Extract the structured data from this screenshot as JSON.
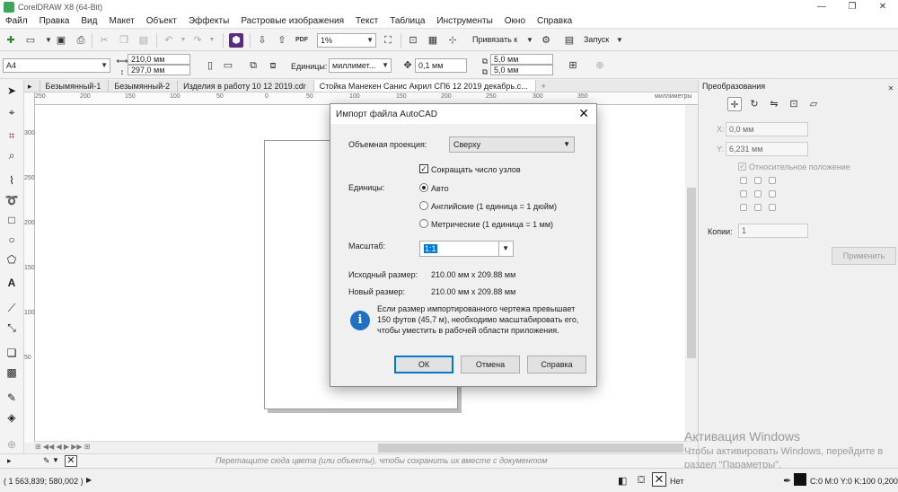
{
  "window": {
    "title": "CorelDRAW X8 (64-Bit)",
    "min": "—",
    "max": "❐",
    "close": "✕"
  },
  "menu": [
    "Файл",
    "Правка",
    "Вид",
    "Макет",
    "Объект",
    "Эффекты",
    "Растровые изображения",
    "Текст",
    "Таблица",
    "Инструменты",
    "Окно",
    "Справка"
  ],
  "toolbar1": {
    "zoom": "1%",
    "snap": "Привязать к",
    "launch": "Запуск",
    "pdf": "PDF"
  },
  "toolbar2": {
    "page_size": "A4",
    "width": "210,0 мм",
    "height": "297,0 мм",
    "units_label": "Единицы:",
    "units": "миллимет...",
    "nudge": "0,1 мм",
    "dup_x": "5,0 мм",
    "dup_y": "5,0 мм"
  },
  "tabs": [
    "Безымянный-1",
    "Безымянный-2",
    "Изделия в работу 10 12 2019.cdr",
    "Стойка  Манекен Санис Акрил СП6  12 2019 декабрь.c..."
  ],
  "ruler": {
    "h_ticks": [
      "250",
      "200",
      "150",
      "100",
      "50",
      "0",
      "50",
      "100",
      "150",
      "200",
      "250",
      "300",
      "350"
    ],
    "h_unit": "миллиметры",
    "v_ticks": [
      "300",
      "250",
      "200",
      "150",
      "100",
      "50"
    ]
  },
  "palette_hint": "Перетащите сюда цвета (или объекты), чтобы сохранить их вместе с документом",
  "docker": {
    "title": "Преобразования",
    "x_label": "X:",
    "x": "0,0 мм",
    "y_label": "Y:",
    "y": "6,231 мм",
    "relative": "Относительное положение",
    "copies_label": "Копии:",
    "copies": "1",
    "apply": "Применить"
  },
  "watermark": {
    "title": "Активация Windows",
    "text": "Чтобы активировать Windows, перейдите в раздел \"Параметры\"."
  },
  "status": {
    "coords": "( 1 563,839; 580,002 )",
    "fill": "Нет",
    "outline": "C:0 M:0 Y:0 K:100  0,200 м"
  },
  "dialog": {
    "title": "Импорт файла AutoCAD",
    "close": "✕",
    "projection_label": "Объемная проекция:",
    "projection": "Сверху",
    "reduce_nodes": "Сокращать число узлов",
    "units_label": "Единицы:",
    "unit_auto": "Авто",
    "unit_english": "Английские (1 единица = 1 дюйм)",
    "unit_metric": "Метрические (1 единица = 1 мм)",
    "scale_label": "Масштаб:",
    "scale": "1:1",
    "orig_size_label": "Исходный размер:",
    "orig_size": "210.00 мм x 209.88 мм",
    "new_size_label": "Новый размер:",
    "new_size": "210.00 мм x 209.88 мм",
    "info_icon": "i",
    "info_line1": "Если размер импортированного чертежа превышает",
    "info_line2": "150 футов (45,7 м), необходимо масштабировать его,",
    "info_line3": "чтобы уместить в рабочей области приложения.",
    "ok": "ОК",
    "cancel": "Отмена",
    "help": "Справка"
  }
}
